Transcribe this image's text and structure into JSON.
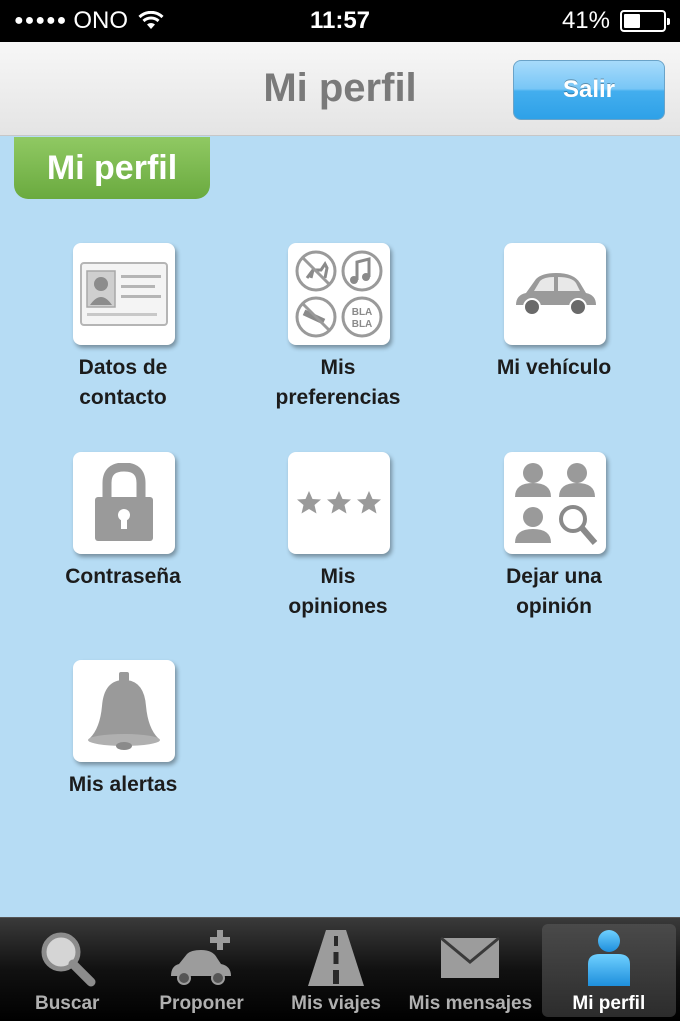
{
  "status_bar": {
    "signal": "●●●●●",
    "carrier": "ONO",
    "time": "11:57",
    "battery": "41%",
    "battery_level": 0.41
  },
  "nav": {
    "title": "Mi perfil",
    "logout_label": "Salir"
  },
  "section": {
    "title": "Mi perfil"
  },
  "tiles": {
    "contact": {
      "line1": "Datos de",
      "line2": "contacto",
      "icon": "id-card-icon"
    },
    "preferences": {
      "line1": "Mis",
      "line2": "preferencias",
      "icon": "preferences-icon"
    },
    "vehicle": {
      "line1": "Mi vehículo",
      "line2": "",
      "icon": "car-icon"
    },
    "password": {
      "line1": "Contraseña",
      "line2": "",
      "icon": "lock-icon"
    },
    "opinions": {
      "line1": "Mis",
      "line2": "opiniones",
      "icon": "stars-icon"
    },
    "leave_opinion": {
      "line1": "Dejar una",
      "line2": "opinión",
      "icon": "people-search-icon"
    },
    "alerts": {
      "line1": "Mis alertas",
      "line2": "",
      "icon": "bell-icon"
    }
  },
  "tab_bar": {
    "search": "Buscar",
    "propose": "Proponer",
    "trips": "Mis viajes",
    "messages": "Mis mensajes",
    "profile": "Mi perfil",
    "active": "profile"
  },
  "colors": {
    "background": "#b6dcf4",
    "accent_green": "#7ab84d",
    "button_blue": "#3aa8ec"
  }
}
